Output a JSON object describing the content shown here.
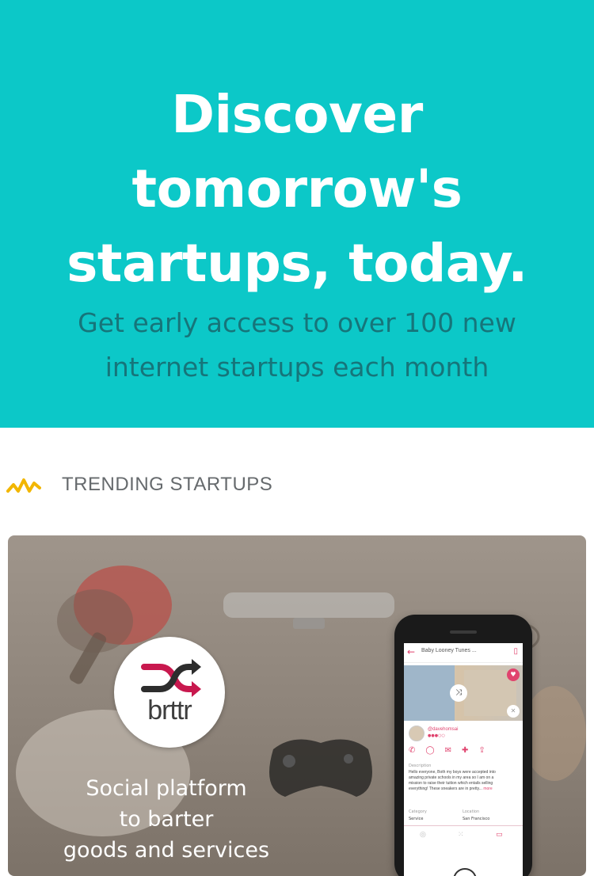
{
  "hero": {
    "title_lines": [
      "Discover",
      "tomorrow's",
      "startups, today."
    ],
    "subtitle_lines": [
      "Get early access to over 100 new",
      "internet startups each month"
    ],
    "colors": {
      "background": "#0cc8c8",
      "subtitle": "#16757a"
    }
  },
  "section": {
    "icon": "trending-zigzag-icon",
    "title": "TRENDING STARTUPS",
    "icon_color": "#f2b600"
  },
  "card": {
    "logo_icon": "shuffle-arrows-icon",
    "logo_text": "brttr",
    "tagline_lines": [
      "Social platform",
      "to barter",
      "goods and services"
    ],
    "accent_color": "#e0436e",
    "phone": {
      "title": "Baby Looney Tunes ...",
      "username": "@davehomsai",
      "rating": "●●●○○",
      "description_label": "Description",
      "description": "Hello everyone, Both my boys were accepted into amazing private schools in my area so I am on a mission to raise their tuition which entails selling everything! These sneakers are in pretty...",
      "more_label": "more",
      "meta_labels": [
        "Category",
        "Location"
      ],
      "meta_values": [
        "Service",
        "San Francisco"
      ]
    }
  }
}
